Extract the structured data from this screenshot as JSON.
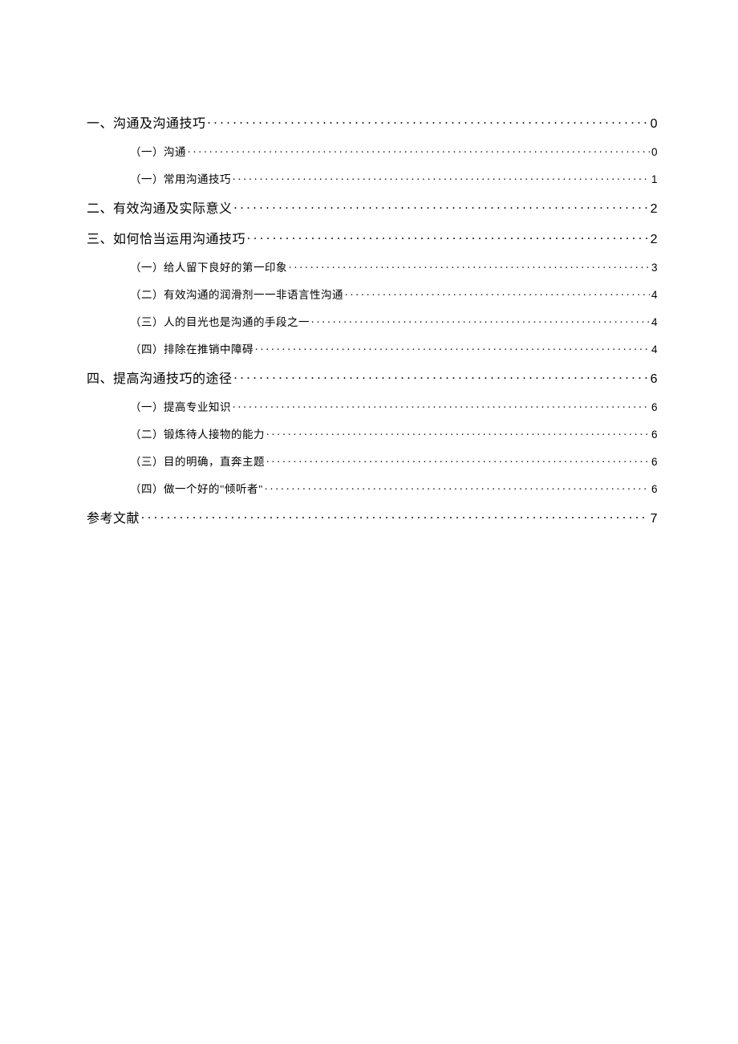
{
  "toc": [
    {
      "level": 1,
      "label": "一、沟通及沟通技巧",
      "page": "0"
    },
    {
      "level": 2,
      "label": "（一）沟通",
      "page": "0"
    },
    {
      "level": 2,
      "label": "（一）常用沟通技巧",
      "page": "1"
    },
    {
      "level": 1,
      "label": "二、有效沟通及实际意义",
      "page": "2"
    },
    {
      "level": 1,
      "label": "三、如何恰当运用沟通技巧",
      "page": "2"
    },
    {
      "level": 2,
      "label": "（一）给人留下良好的第一印象",
      "page": "3"
    },
    {
      "level": 2,
      "label": "（二）有效沟通的润滑剂一一非语言性沟通",
      "page": "4"
    },
    {
      "level": 2,
      "label": "（三）人的目光也是沟通的手段之一",
      "page": "4"
    },
    {
      "level": 2,
      "label": "（四）排除在推销中障碍",
      "page": "4"
    },
    {
      "level": 1,
      "label": "四、提高沟通技巧的途径",
      "page": "6"
    },
    {
      "level": 2,
      "label": "（一）提高专业知识",
      "page": "6"
    },
    {
      "level": 2,
      "label": "（二）锻炼待人接物的能力",
      "page": "6"
    },
    {
      "level": 2,
      "label": "（三）目的明确，直奔主题",
      "page": "6"
    },
    {
      "level": 2,
      "label": "（四）做一个好的\"倾听者\"",
      "page": "6"
    },
    {
      "level": 1,
      "label": "参考文献",
      "page": "7"
    }
  ]
}
